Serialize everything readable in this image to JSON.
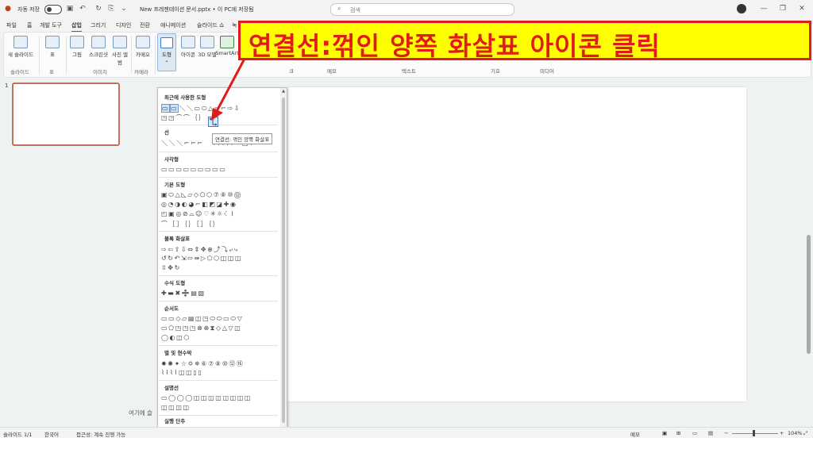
{
  "titlebar": {
    "autosave_label": "자동 저장",
    "autosave_state": "끔",
    "filename": "New 프레젠테이션 문서.pptx • 이 PC에 저장됨",
    "search_placeholder": "검색"
  },
  "tabs": [
    "파일",
    "홈",
    "개발 도구",
    "삽입",
    "그리기",
    "디자인",
    "전환",
    "애니메이션",
    "슬라이드 쇼",
    "녹"
  ],
  "active_tab": "삽입",
  "ribbon": {
    "new_slide": "새 슬라이드",
    "table": "표",
    "picture": "그림",
    "screenshot": "스크린샷",
    "photo_album": "사진 앨범",
    "cameo": "카메오",
    "shapes": "도형",
    "icons": "아이콘",
    "model3d": "3D 모델",
    "smartart": "SmartArt",
    "groups": [
      "슬라이드",
      "표",
      "이미지",
      "카메라"
    ]
  },
  "header_row": [
    "크",
    "메모",
    "텍스트",
    "기호",
    "미디어"
  ],
  "slide_number": "1",
  "notes_placeholder": "여기에 슬",
  "shapes_menu": {
    "sections": [
      {
        "title": "최근에 사용한 도형"
      },
      {
        "title": "선"
      },
      {
        "title": "사각형"
      },
      {
        "title": "기본 도형"
      },
      {
        "title": "블록 화살표"
      },
      {
        "title": "수식 도형"
      },
      {
        "title": "순서도"
      },
      {
        "title": "별 및 현수막"
      },
      {
        "title": "설명선"
      },
      {
        "title": "실행 단추"
      }
    ],
    "tooltip": "연결선: 꺾인 양쪽 화살표"
  },
  "callout_text": "연결선:꺾인 양쪽 화살표 아이콘 클릭",
  "status": {
    "slide": "슬라이드 1/1",
    "language": "한국어",
    "accessibility": "접근성: 계속 진행 가능",
    "notes": "메모",
    "zoom": "104%"
  },
  "colors": {
    "accent": "#c43e1c",
    "callout_bg": "#ffff00",
    "callout_text": "#e01b1b"
  }
}
